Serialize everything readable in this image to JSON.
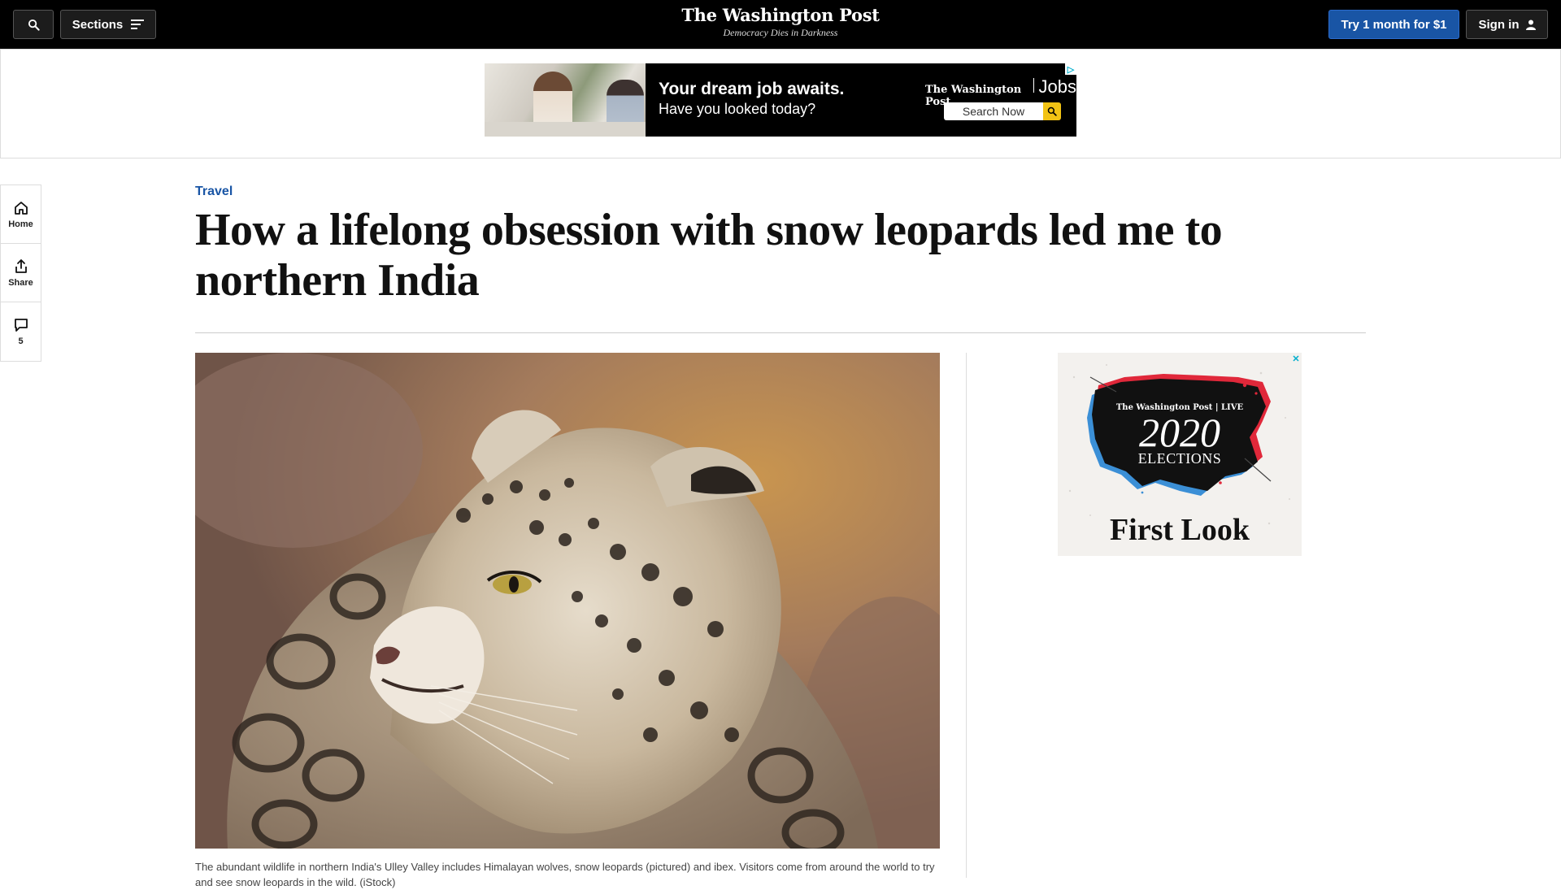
{
  "topbar": {
    "search_label": "Search",
    "sections_label": "Sections",
    "masthead_title": "The Washington Post",
    "masthead_tagline": "Democracy Dies in Darkness",
    "try_label": "Try 1 month for $1",
    "signin_label": "Sign in"
  },
  "top_ad": {
    "headline": "Your dream job awaits.",
    "subline": "Have you looked today?",
    "brand": "The Washington Post",
    "brand_suffix": "Jobs",
    "search_button": "Search Now",
    "adchoice_glyph": "▷"
  },
  "rail": {
    "home_label": "Home",
    "share_label": "Share",
    "comments_count": "5"
  },
  "article": {
    "section": "Travel",
    "headline": "How a lifelong obsession with snow leopards led me to northern India",
    "caption": "The abundant wildlife in northern India's Ulley Valley includes Himalayan wolves, snow leopards (pictured) and ibex. Visitors come from around the world to try and see snow leopards in the wild. (iStock)"
  },
  "side_ad": {
    "brand": "The Washington Post | LIVE",
    "year": "2020",
    "title": "ELECTIONS",
    "tagline": "First Look",
    "close_glyph": "✕"
  },
  "colors": {
    "topbar_bg": "#000000",
    "accent_blue": "#1955a5",
    "kicker_blue": "#1955a5",
    "ad_yellow": "#f2c314"
  }
}
